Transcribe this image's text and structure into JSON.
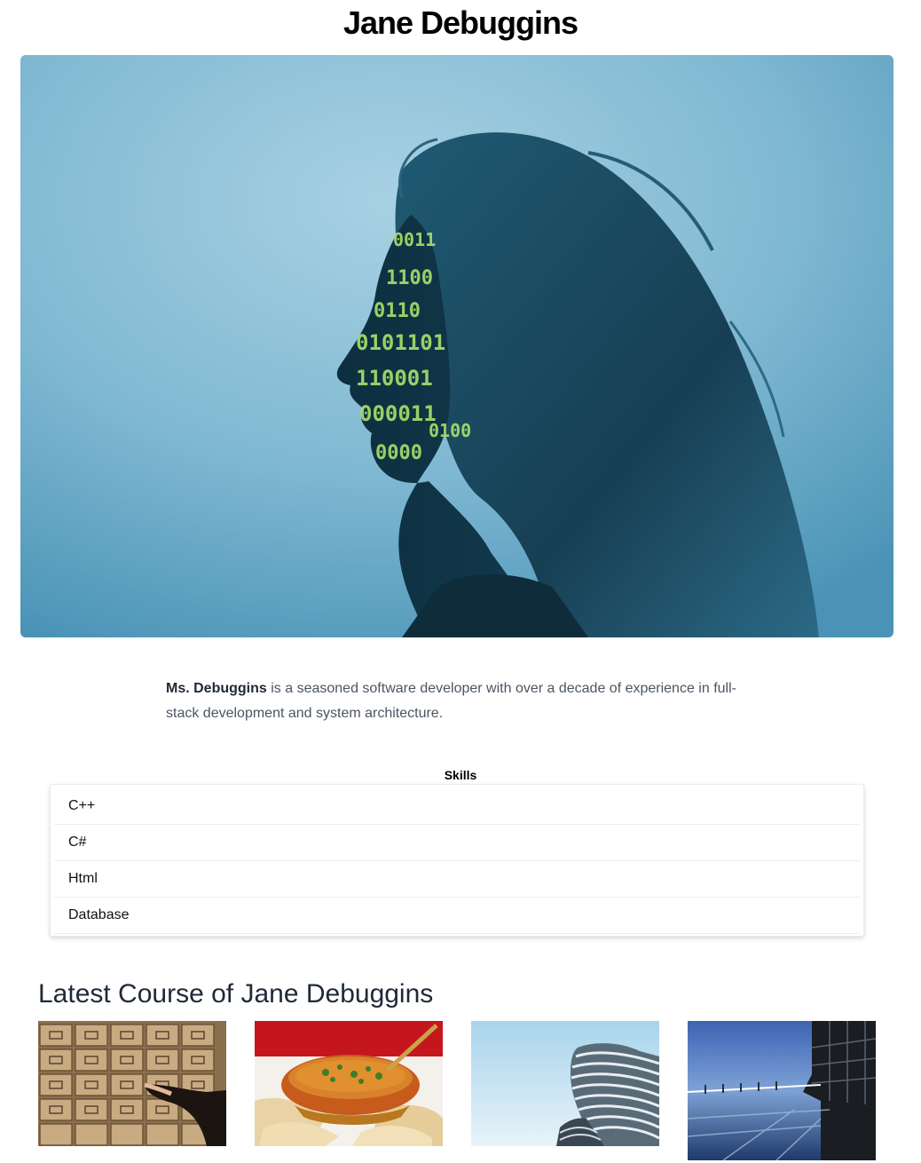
{
  "profile": {
    "name": "Jane Debuggins",
    "bio_name": "Ms. Debuggins",
    "bio_text": " is a seasoned software developer with over a decade of experience in full-stack development and system architecture."
  },
  "skills": {
    "heading": "Skills",
    "items": [
      "C++",
      "C#",
      "Html",
      "Database"
    ]
  },
  "courses": {
    "heading": "Latest Course of Jane Debuggins",
    "items": [
      {
        "image": "filing-cabinet-drawers-image"
      },
      {
        "image": "curry-bowl-naan-image"
      },
      {
        "image": "spiral-tower-building-image"
      },
      {
        "image": "glass-building-water-reflection-image"
      }
    ]
  },
  "hero_overlay_text": [
    "0011",
    "1100",
    "0110",
    "0101101",
    "110001",
    "000011",
    "0000",
    "0100"
  ],
  "colors": {
    "hero_bg": "#7ab4cf",
    "hair": "#153f55",
    "binary_green": "#a9e26a",
    "bio_text": "#4b5563",
    "divider": "#ececec"
  }
}
